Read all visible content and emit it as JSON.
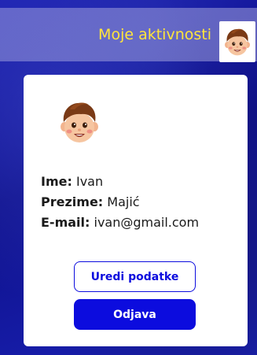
{
  "header": {
    "title": "Moje aktivnosti",
    "avatar_icon": "boy-avatar-icon"
  },
  "profile": {
    "avatar_icon": "boy-avatar-icon",
    "fields": [
      {
        "label": "Ime:",
        "value": "Ivan"
      },
      {
        "label": "Prezime:",
        "value": "Majić"
      },
      {
        "label": "E-mail:",
        "value": "ivan@gmail.com"
      }
    ]
  },
  "actions": {
    "edit_label": "Uredi podatke",
    "logout_label": "Odjava"
  },
  "colors": {
    "accent": "#0c0cde",
    "header_text": "#ffe53b",
    "background": "#16179a"
  }
}
